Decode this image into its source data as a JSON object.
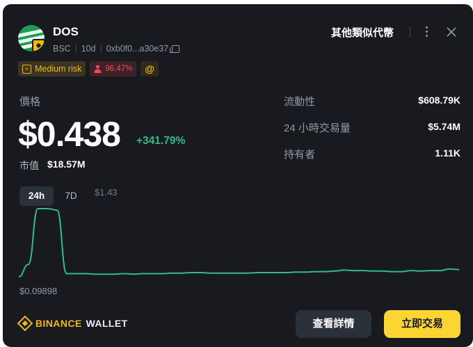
{
  "token": {
    "name": "DOS",
    "chain": "BSC",
    "age": "10d",
    "address": "0xb0f0...a30e37"
  },
  "header": {
    "similar_label": "其他類似代幣"
  },
  "tags": {
    "risk": "Medium risk",
    "holder_pct": "96.47%",
    "at_symbol": "@"
  },
  "price": {
    "label": "價格",
    "value": "$0.438",
    "change": "+341.79%",
    "market_cap_label": "市值",
    "market_cap_value": "$18.57M"
  },
  "stats": [
    {
      "label": "流動性",
      "value": "$608.79K"
    },
    {
      "label": "24 小時交易量",
      "value": "$5.74M"
    },
    {
      "label": "持有者",
      "value": "1.11K"
    }
  ],
  "chart": {
    "tabs": [
      "24h",
      "7D"
    ],
    "active_tab": "24h",
    "high_label": "$1.43",
    "low_label": "$0.09898",
    "line_color": "#2ebd85",
    "series": [
      0.099,
      0.34,
      1.43,
      1.43,
      1.4,
      0.16,
      0.16,
      0.16,
      0.15,
      0.15,
      0.15,
      0.16,
      0.15,
      0.16,
      0.16,
      0.16,
      0.17,
      0.17,
      0.18,
      0.18,
      0.17,
      0.17,
      0.17,
      0.17,
      0.17,
      0.18,
      0.18,
      0.18,
      0.18,
      0.19,
      0.19,
      0.2,
      0.2,
      0.21,
      0.23,
      0.22,
      0.22,
      0.21,
      0.21,
      0.2,
      0.2,
      0.22,
      0.21,
      0.22,
      0.22,
      0.25,
      0.24
    ]
  },
  "footer": {
    "brand_primary": "BINANCE",
    "brand_secondary": "WALLET",
    "details_label": "查看詳情",
    "trade_label": "立即交易"
  },
  "colors": {
    "accent": "#f0b90b",
    "positive": "#2ebd85",
    "negative": "#f6465d"
  }
}
